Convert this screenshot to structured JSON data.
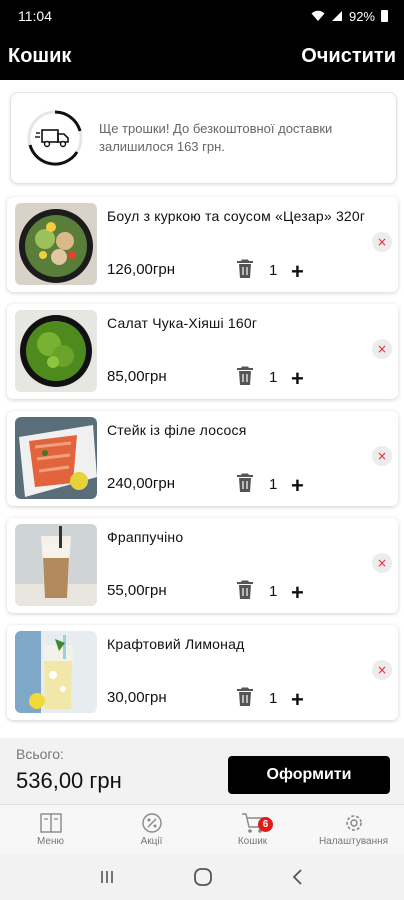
{
  "status": {
    "time": "11:04",
    "battery": "92%"
  },
  "header": {
    "title": "Кошик",
    "clear_label": "Очистити"
  },
  "delivery": {
    "message": "Ще трошки! До безкоштовної доставки залишилося 163 грн."
  },
  "cart": {
    "items": [
      {
        "name": "Боул з куркою та соусом «Цезар» 320г",
        "price": "126,00грн",
        "qty": "1"
      },
      {
        "name": "Салат Чука-Хіяші 160г",
        "price": "85,00грн",
        "qty": "1"
      },
      {
        "name": "Стейк із філе лосося",
        "price": "240,00грн",
        "qty": "1"
      },
      {
        "name": "Фраппучіно",
        "price": "55,00грн",
        "qty": "1"
      },
      {
        "name": "Крафтовий Лимонад",
        "price": "30,00грн",
        "qty": "1"
      }
    ],
    "plus": "+",
    "remove": "×"
  },
  "summary": {
    "total_label": "Всього:",
    "total_value": "536,00 грн",
    "checkout_label": "Оформити"
  },
  "nav": {
    "items": [
      {
        "label": "Меню",
        "icon": "menu-book-icon"
      },
      {
        "label": "Акції",
        "icon": "percent-icon"
      },
      {
        "label": "Кошик",
        "icon": "cart-icon",
        "badge": "6"
      },
      {
        "label": "Налаштування",
        "icon": "gear-icon"
      }
    ]
  },
  "colors": {
    "accent": "#000000",
    "badge": "#e31b1b",
    "remove": "#e32233"
  }
}
